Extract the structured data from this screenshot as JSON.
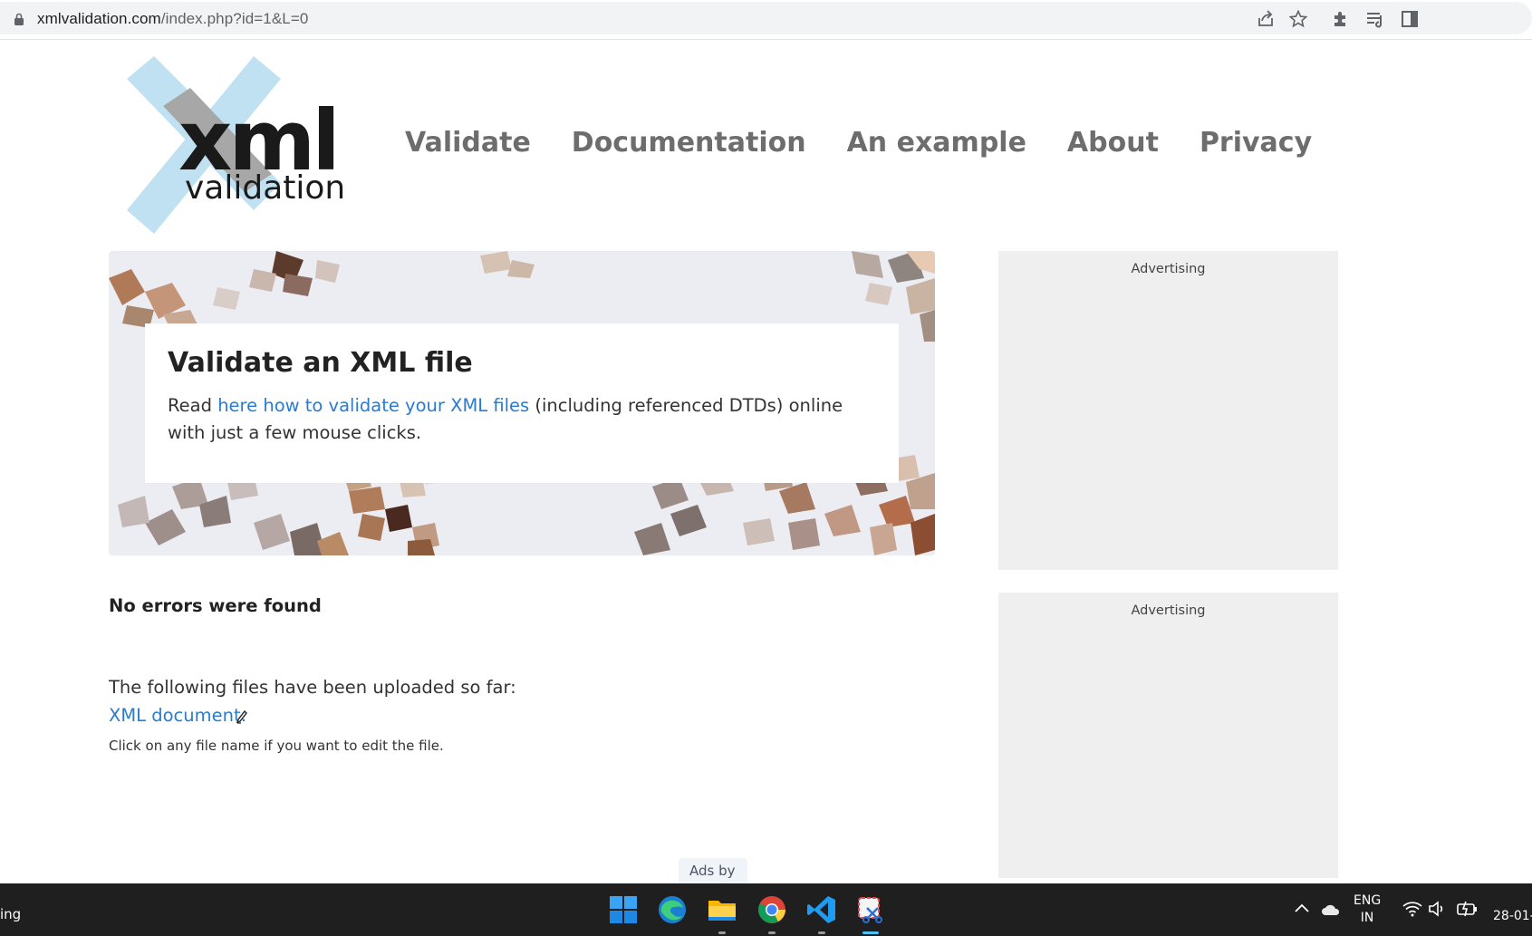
{
  "browser": {
    "url_host": "xmlvalidation.com",
    "url_path": "/index.php?id=1&L=0",
    "icons": [
      "lock-icon",
      "share-icon",
      "bookmark-star-icon",
      "extensions-icon",
      "reading-list-icon",
      "side-panel-icon"
    ]
  },
  "site": {
    "logo_word": "xml",
    "logo_sub": "validation",
    "nav": [
      "Validate",
      "Documentation",
      "An example",
      "About",
      "Privacy"
    ]
  },
  "hero": {
    "title": "Validate an XML file",
    "text_before": "Read ",
    "link_text": "here how to validate your XML files",
    "text_after": " (including referenced DTDs) online with just a few mouse clicks."
  },
  "content": {
    "status": "No errors were found",
    "uploaded_intro": "The following files have been uploaded so far:",
    "file_link": "XML document:",
    "hint": "Click on any file name if you want to edit the file."
  },
  "ads": {
    "label_1": "Advertising",
    "label_2": "Advertising",
    "ads_by": "Ads by"
  },
  "taskbar": {
    "left_fragment": "ing",
    "apps": [
      "windows-start-icon",
      "edge-icon",
      "file-explorer-icon",
      "chrome-icon",
      "vscode-icon",
      "snipping-tool-icon"
    ],
    "lang_top": "ENG",
    "lang_bottom": "IN",
    "date": "28-01-"
  },
  "colors": {
    "link": "#2a7bd0",
    "nav": "#6d6d6d",
    "ad_bg": "#efefef",
    "taskbar": "#1f1f1f"
  }
}
